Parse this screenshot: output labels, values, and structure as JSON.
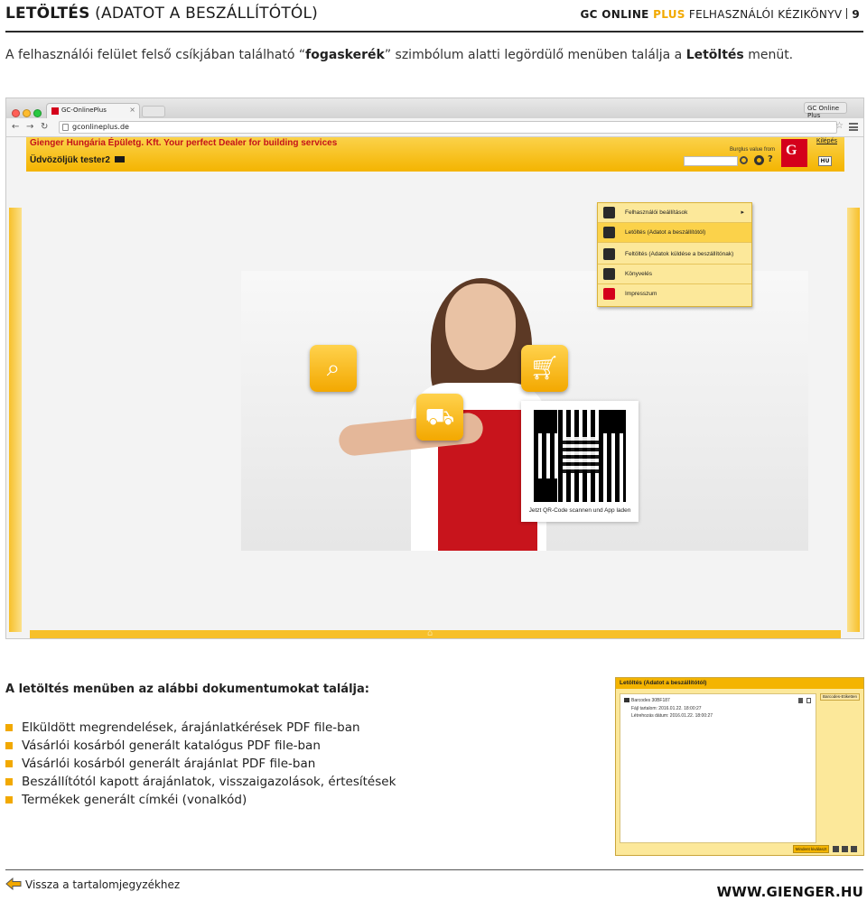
{
  "header": {
    "title_bold": "LETÖLTÉS",
    "title_rest": " (ADATOT A BESZÁLLÍTÓTÓL)",
    "brand_gc": "GC ONLINE",
    "brand_plus": " PLUS",
    "brand_rest": " FELHASZNÁLÓI KÉZIKÖNYV",
    "page_number": "9"
  },
  "intro": {
    "part1": "A felhasználói felület felső csíkjában található “",
    "bold1": "fogaskerék",
    "part2": "” szimbólum alatti legördülő menüben találja a ",
    "bold2": "Letöltés",
    "part3": " menüt."
  },
  "browser": {
    "tab_title": "GC-OnlinePlus",
    "window_title": "GC Online Plus",
    "url": "gconlineplus.de",
    "banner_text": "Gienger Hungária Épületg. Kft.  Your perfect Dealer for building services",
    "welcome": "Üdvözöljük tester2",
    "burglar": "Burglus value from",
    "logout": "Kilépés",
    "lang": "HU",
    "logo_letter": "G",
    "menu": [
      {
        "label": "Felhasználói beállítások",
        "arrow": "▸"
      },
      {
        "label": "Letöltés (Adatot a beszállítótól)"
      },
      {
        "label": "Feltöltés (Adatok küldése a beszállítónak)"
      },
      {
        "label": "Könyvelés"
      },
      {
        "label": "Impresszum"
      }
    ],
    "qr_caption": "Jetzt QR-Code scannen und App laden"
  },
  "section": {
    "heading": "A letöltés menüben az alábbi dokumentumokat találja:",
    "bullets": [
      "Elküldött megrendelések, árajánlatkérések PDF file-ban",
      "Vásárlói kosárból generált katalógus  PDF file-ban",
      "Vásárlói kosárból generált árajánlat PDF file-ban",
      "Beszállítótól kapott árajánlatok, visszaigazolások, értesítések",
      "Termékek generált címkéi (vonalkód)"
    ]
  },
  "mini_window": {
    "title": "Letöltés (Adatot a beszállítótól)",
    "line1": "Barcodes 30BF187",
    "line2": "Fájl tartalom: 2016.01.22. 18:00:27",
    "line3": "Létrehozás dátum: 2016.01.22. 18:00:27",
    "side_button": "Barcodes-Etiketten",
    "footer_button": "Mindent kiválaszt"
  },
  "footer": {
    "back_label": "Vissza a tartalomjegyzékhez",
    "website": "WWW.GIENGER.HU"
  },
  "colors": {
    "accent": "#f2a900",
    "banner_yellow": "#f4b400",
    "brand_red": "#d4001b"
  }
}
